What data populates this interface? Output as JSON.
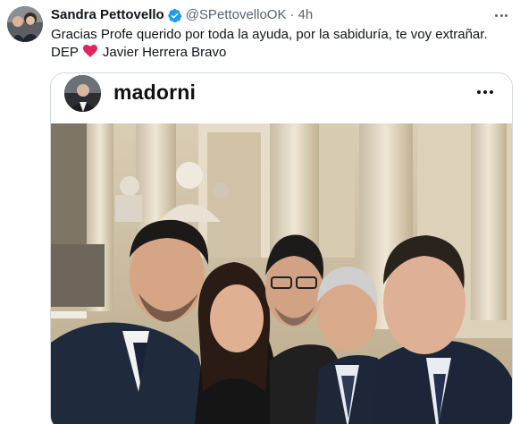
{
  "tweet": {
    "display_name": "Sandra Pettovello",
    "handle": "@SPettovelloOK",
    "separator": "·",
    "time": "4h",
    "text_line1": "Gracias Profe querido por toda la ayuda, por la sabiduría, te voy extrañar.",
    "text_line2_prefix": "DEP",
    "text_line2_suffix": "Javier Herrera Bravo",
    "verified_icon": "verified-badge-icon",
    "heart_icon": "red-heart-icon",
    "more_icon": "more-horizontal-icon"
  },
  "embedded_post": {
    "username": "madorni",
    "more_icon": "more-horizontal-icon"
  },
  "colors": {
    "text_primary": "#0f1419",
    "text_secondary": "#536471",
    "verified_blue": "#1d9bf0",
    "heart_red": "#e0245e",
    "border": "#cfd9de"
  }
}
